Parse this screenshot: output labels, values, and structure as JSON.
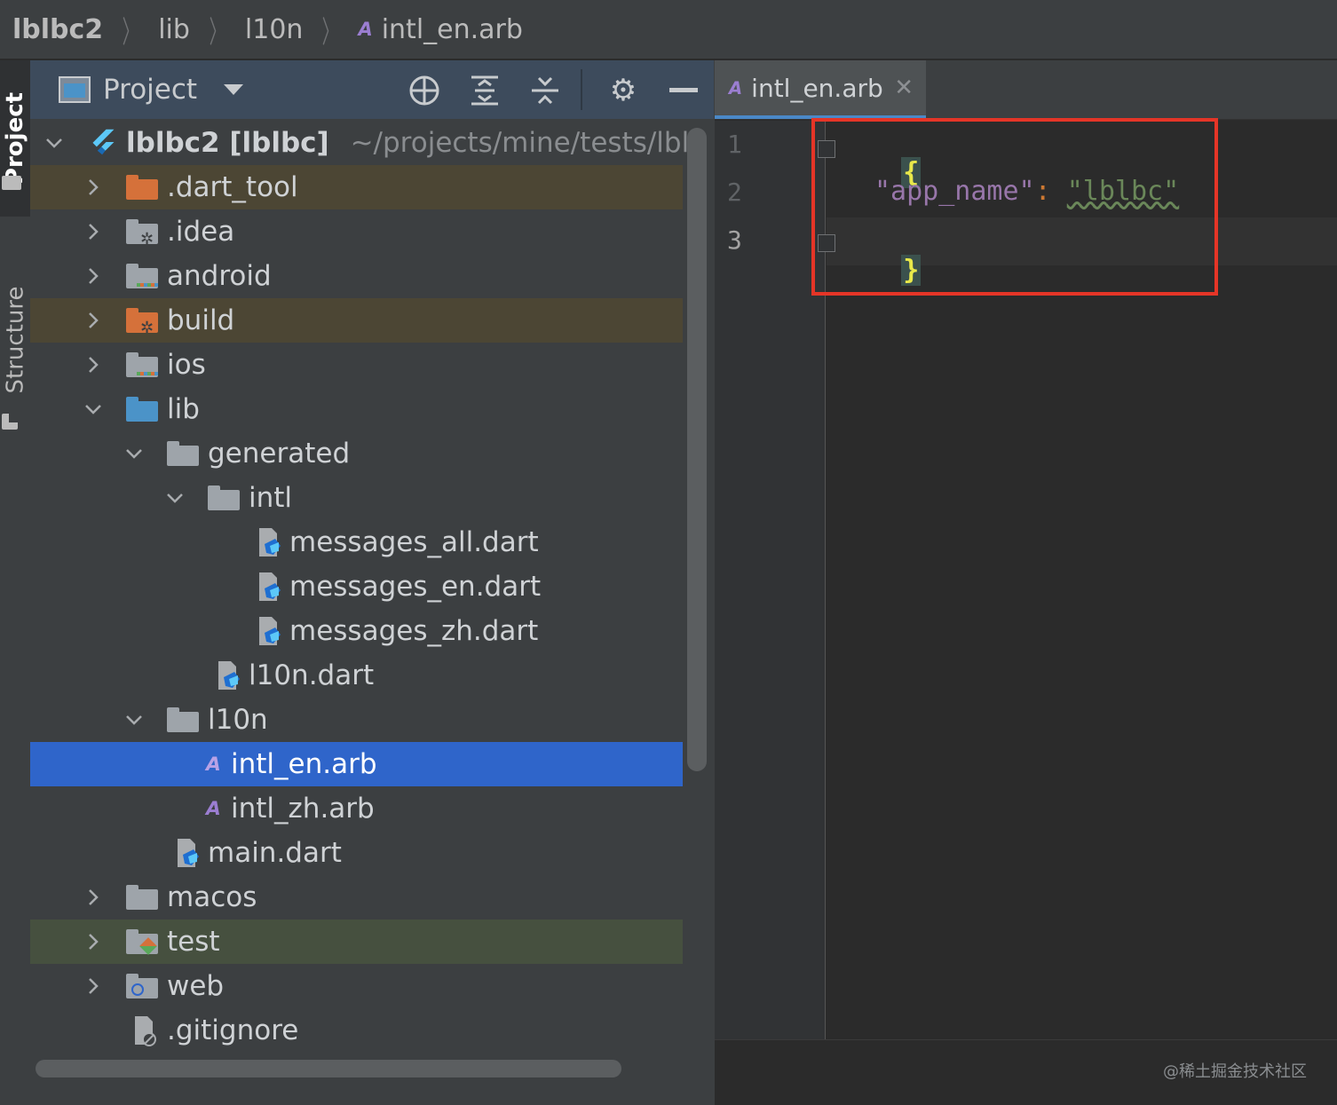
{
  "breadcrumb": {
    "root": "lblbc2",
    "items": [
      "lib",
      "l10n",
      "intl_en.arb"
    ]
  },
  "side_tabs": {
    "project": "Project",
    "structure": "Structure"
  },
  "project_panel": {
    "title": "Project",
    "toolbar_icons": [
      "locate-icon",
      "expand-all-icon",
      "collapse-all-icon",
      "gear-icon",
      "minimize-icon"
    ],
    "tree": [
      {
        "label": "lblbc2 [lblbc]",
        "suffix": "~/projects/mine/tests/lbl",
        "icon": "flutter-icon",
        "expanded": true
      },
      {
        "label": ".dart_tool",
        "icon": "folder-excluded-icon",
        "expanded": false
      },
      {
        "label": ".idea",
        "icon": "folder-config-icon",
        "expanded": false
      },
      {
        "label": "android",
        "icon": "folder-module-icon",
        "expanded": false
      },
      {
        "label": "build",
        "icon": "folder-build-icon",
        "expanded": false
      },
      {
        "label": "ios",
        "icon": "folder-module-icon",
        "expanded": false
      },
      {
        "label": "lib",
        "icon": "folder-source-icon",
        "expanded": true
      },
      {
        "label": "generated",
        "icon": "folder-icon",
        "expanded": true
      },
      {
        "label": "intl",
        "icon": "folder-icon",
        "expanded": true
      },
      {
        "label": "messages_all.dart",
        "icon": "dart-file-icon"
      },
      {
        "label": "messages_en.dart",
        "icon": "dart-file-icon"
      },
      {
        "label": "messages_zh.dart",
        "icon": "dart-file-icon"
      },
      {
        "label": "l10n.dart",
        "icon": "dart-file-icon"
      },
      {
        "label": "l10n",
        "icon": "folder-icon",
        "expanded": true
      },
      {
        "label": "intl_en.arb",
        "icon": "arb-file-icon",
        "selected": true
      },
      {
        "label": "intl_zh.arb",
        "icon": "arb-file-icon"
      },
      {
        "label": "main.dart",
        "icon": "dart-file-icon"
      },
      {
        "label": "macos",
        "icon": "folder-icon",
        "expanded": false
      },
      {
        "label": "test",
        "icon": "folder-test-icon",
        "expanded": false
      },
      {
        "label": "web",
        "icon": "folder-web-icon",
        "expanded": false
      },
      {
        "label": ".gitignore",
        "icon": "ignore-file-icon"
      }
    ]
  },
  "editor": {
    "tab_label": "intl_en.arb",
    "line_numbers": [
      "1",
      "2",
      "3"
    ],
    "lines": {
      "open_brace": "{",
      "key": "\"app_name\"",
      "colon": ":",
      "value": "\"lblbc\"",
      "close_brace": "}"
    }
  },
  "watermark": "@稀土掘金技术社区",
  "colors": {
    "selection": "#2f65ca",
    "highlight_box": "#e53527",
    "excluded_row": "#4c4634",
    "test_row": "#46503f"
  }
}
